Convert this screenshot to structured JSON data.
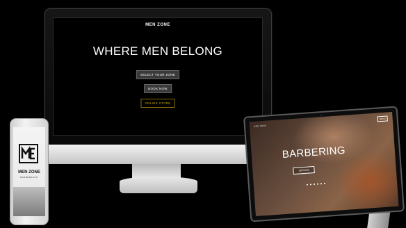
{
  "site": {
    "logo": "MEN ZONE",
    "headline": "WHERE MEN BELONG",
    "buttons": {
      "select_zone": "SELECT YOUR ZONE",
      "book_now": "BOOK NOW",
      "online_store": "ONLINE STORE"
    }
  },
  "phone": {
    "brand": "MEN ZONE",
    "tagline": "BARBERSHOP"
  },
  "tablet": {
    "nav_brand": "MEN ZONE",
    "nav_menu": "MENU",
    "title": "BARBERING",
    "button": "SERVICE"
  },
  "colors": {
    "background": "#000000",
    "accent_gold": "#c8a000",
    "button_gray": "#3a3a3a"
  }
}
